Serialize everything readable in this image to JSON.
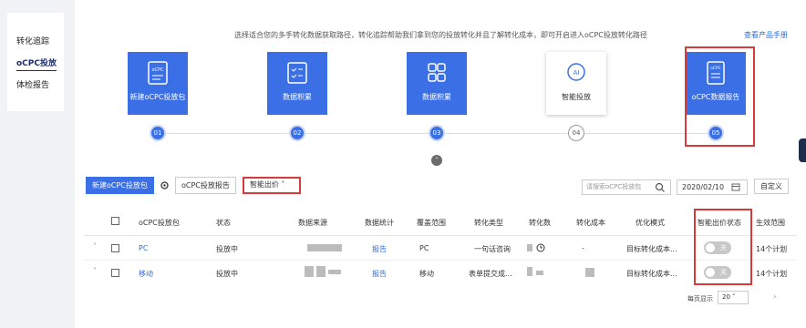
{
  "sidebar": {
    "items": [
      {
        "label": "转化追踪",
        "active": false
      },
      {
        "label": "oCPC投放",
        "active": true
      },
      {
        "label": "体检报告",
        "active": false
      }
    ]
  },
  "intro": {
    "text": "选择适合您的多手转化数据获取路径，转化追踪帮助我们拿到您的投放转化并且了解转化成本，即可开启进入oCPC投放转化路径",
    "report_link": "查看产品手册"
  },
  "steps": [
    {
      "label": "新建oCPC投放包",
      "number": "01",
      "icon": "ocpc-doc-icon",
      "style": "blue"
    },
    {
      "label": "数据积累",
      "number": "02",
      "icon": "checklist-icon",
      "style": "blue"
    },
    {
      "label": "数据积累",
      "number": "03",
      "icon": "grid-icon",
      "style": "blue"
    },
    {
      "label": "智能投放",
      "number": "04",
      "icon": "ai-icon",
      "style": "gray"
    },
    {
      "label": "oCPC数据报告",
      "number": "05",
      "icon": "report-icon",
      "style": "blue"
    }
  ],
  "toolbar": {
    "new_button": "新建oCPC投放包",
    "report_button": "oCPC投放报告",
    "filter_label": "智能出价 ˅",
    "search_placeholder": "请搜索oCPC投放包",
    "date": "2020/02/10",
    "custom_button": "自定义"
  },
  "table": {
    "columns": [
      "oCPC投放包",
      "状态",
      "数据来源",
      "数据统计",
      "覆盖范围",
      "转化类型",
      "转化数",
      "转化成本",
      "优化模式",
      "智能出价状态",
      "生效范围"
    ],
    "rows": [
      {
        "name": "PC",
        "status": "投放中",
        "stats": "报告",
        "scope": "PC",
        "conv_type": "一句话咨询",
        "conv_cost": "-",
        "mode": "目标转化成本...",
        "toggle": "关",
        "effect": "14个计划"
      },
      {
        "name": "移动",
        "status": "投放中",
        "stats": "报告",
        "scope": "移动",
        "conv_type": "表单提交成...",
        "conv_cost": "",
        "mode": "目标转化成本...",
        "toggle": "关",
        "effect": "14个计划"
      }
    ]
  },
  "pagination": {
    "label": "每页显示",
    "page_size": "20",
    "next": "›"
  },
  "colors": {
    "primary": "#3a6fe6",
    "highlight": "#d63a3a",
    "sidebar_active": "#1f2d6b"
  }
}
